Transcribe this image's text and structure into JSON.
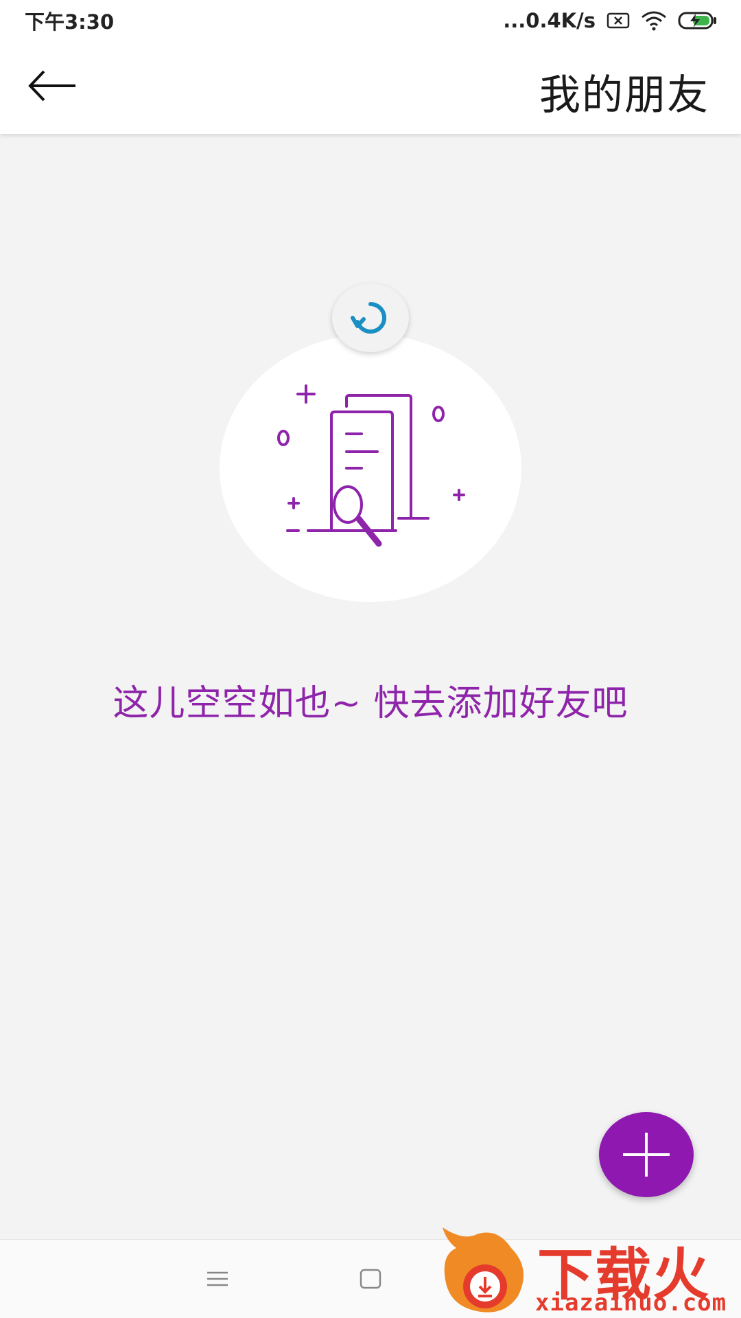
{
  "status_bar": {
    "time": "下午3:30",
    "network_speed": "...0.4K/s",
    "icons": [
      "sim-x-icon",
      "wifi-icon",
      "battery-charging-icon"
    ]
  },
  "app_bar": {
    "title": "我的朋友",
    "back_icon": "arrow-left-icon"
  },
  "empty_state": {
    "message": "这儿空空如也~ 快去添加好友吧",
    "refresh_icon": "refresh-icon",
    "illustration": "document-search-illustration"
  },
  "fab": {
    "icon": "plus-icon"
  },
  "nav_bar": {
    "icons": [
      "menu-icon",
      "home-icon"
    ]
  },
  "watermark": {
    "logo_text": "下载火",
    "site": "xiazaihuo.com"
  },
  "colors": {
    "accent": "#8e18b0",
    "accent_text": "#8e24aa",
    "refresh_blue": "#1a8fc4",
    "background": "#f3f3f3"
  }
}
